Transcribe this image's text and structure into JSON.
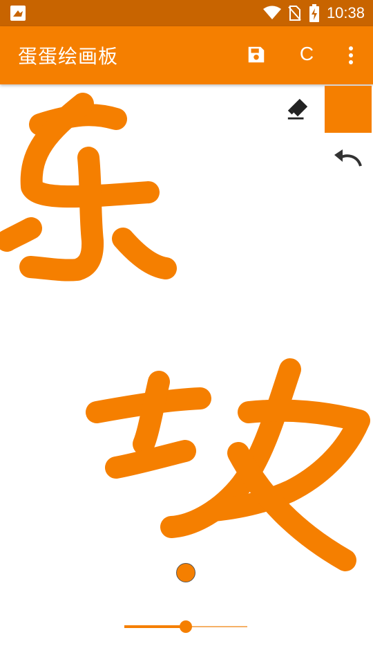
{
  "status_bar": {
    "time": "10:38",
    "icons": [
      "app-notification-icon",
      "wifi-icon",
      "no-sim-icon",
      "battery-charging-icon"
    ]
  },
  "app_bar": {
    "title": "蛋蛋绘画板",
    "clear_label": "C",
    "actions": [
      "save-icon",
      "clear",
      "more-vert-icon"
    ]
  },
  "tools": {
    "eraser": "eraser-icon",
    "undo": "undo-icon",
    "current_color": "#f57f00"
  },
  "brush": {
    "size_level": 0.5,
    "color": "#f57f00"
  },
  "colors": {
    "accent": "#f57f00",
    "status": "#c86400"
  }
}
